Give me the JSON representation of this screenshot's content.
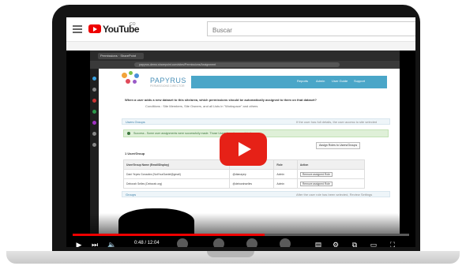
{
  "youtube": {
    "logo_text": "YouTube",
    "country_code": "CO",
    "search_placeholder": "Buscar"
  },
  "inner_browser": {
    "tab_title": "Permissions · SharePoint",
    "address": "papyrus-demo.sharepoint.com/sites/Permissions/Assignment",
    "app": {
      "name": "PAPYRUS",
      "tagline": "PERMISSIONS DIRECTOR",
      "nav": [
        "Reports",
        "Admin",
        "User Guide",
        "Support"
      ],
      "question": "When a user adds a new dataset to this site/area, which permissions should be automatically assigned to them on that dataset?",
      "conditions": "Conditions : Site Members, Site Owners, and all Lists in \"Workspace\" and others",
      "section_header": "Users Groups",
      "section_note": "If the user has full details, the user access to site selected",
      "alert": "Success - Some user assignments were successfully made. Those Users have been updated.",
      "add_button": "Assign Roles to Users/Groups",
      "group_heading": "1 User/Group",
      "table": {
        "headers": [
          "User/Group Name (Email/Display)",
          "ID",
          "Role",
          "Action"
        ],
        "rows": [
          [
            "Dani Yepes Gonzalez (NotYourDaniel@gmail)",
            "@dianayep",
            "Admin",
            "Remove assigned Role"
          ],
          [
            "Deborah Selles (Deborah.org)",
            "@deborahselles",
            "Admin",
            "Remove assigned Role"
          ]
        ]
      },
      "footer_label": "Groups",
      "footer_note": "After the user role has been selected, Review Settings"
    }
  },
  "player": {
    "time": "0:48 / 12:04",
    "progress_fraction": 0.57
  },
  "colors": {
    "youtube_red": "#e62117",
    "papyrus_blue": "#4aa6c8"
  }
}
